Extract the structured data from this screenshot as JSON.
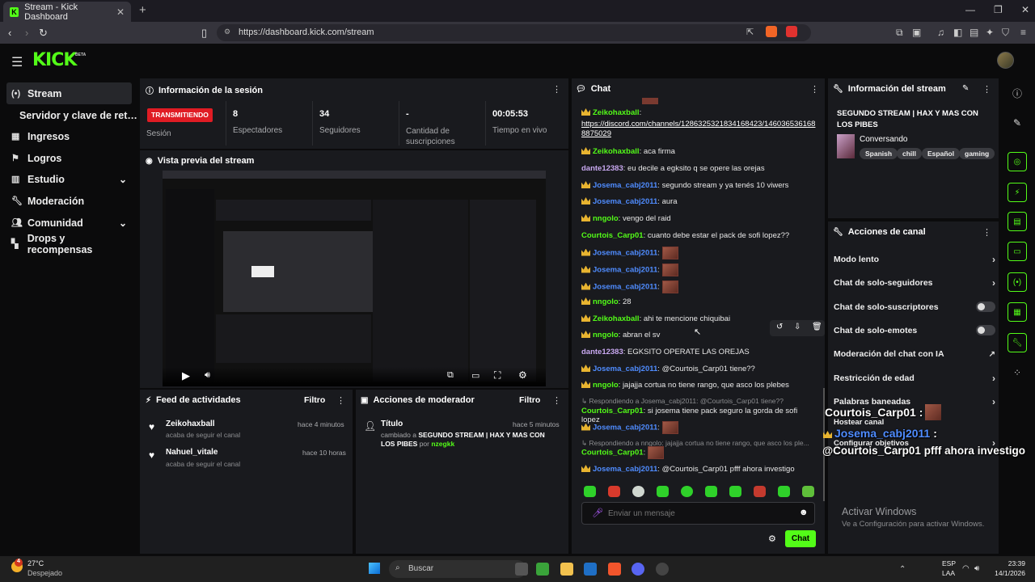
{
  "browser": {
    "tab_title": "Stream - Kick Dashboard",
    "url": "https://dashboard.kick.com/stream",
    "window_controls": [
      "minimize-icon",
      "restore-icon",
      "close-icon"
    ]
  },
  "app": {
    "logo": "KICK",
    "logo_badge": "BETA"
  },
  "sidebar": {
    "items": [
      {
        "label": "Stream",
        "icon": "broadcast-icon",
        "active": true
      },
      {
        "label": "Servidor y clave de retransmisión",
        "icon": "",
        "sub": true
      },
      {
        "label": "Ingresos",
        "icon": "bar-chart-icon"
      },
      {
        "label": "Logros",
        "icon": "flag-icon"
      },
      {
        "label": "Estudio",
        "icon": "grid-icon",
        "chevron": true
      },
      {
        "label": "Moderación",
        "icon": "wrench-icon"
      },
      {
        "label": "Comunidad",
        "icon": "people-icon",
        "chevron": true
      },
      {
        "label": "Drops y recompensas",
        "icon": "gift-icon"
      }
    ]
  },
  "session": {
    "title": "Información de la sesión",
    "live_badge": "TRANSMITIENDO",
    "stats": [
      {
        "value": "",
        "label": "Sesión"
      },
      {
        "value": "8",
        "label": "Espectadores"
      },
      {
        "value": "34",
        "label": "Seguidores"
      },
      {
        "value": "-",
        "label": "Cantidad de suscripciones"
      },
      {
        "value": "00:05:53",
        "label": "Tiempo en vivo"
      }
    ]
  },
  "preview": {
    "title": "Vista previa del stream"
  },
  "activity": {
    "title": "Feed de actividades",
    "filter": "Filtro",
    "items": [
      {
        "user": "Zeikohaxball",
        "text": "acaba de seguir el canal",
        "time": "hace 4 minutos"
      },
      {
        "user": "Nahuel_vitale",
        "text": "acaba de seguir el canal",
        "time": "hace 10 horas"
      }
    ]
  },
  "modactions": {
    "title": "Acciones de moderador",
    "filter": "Filtro",
    "item": {
      "label": "Título",
      "time": "hace 5 minutos",
      "text_prefix": "cambiado a ",
      "title_value": "SEGUNDO STREAM | HAX Y MAS CON LOS PIBES",
      "by": " por ",
      "mod": "nzegkk"
    }
  },
  "chat": {
    "title": "Chat",
    "lines": [
      {
        "user": "Zeikohaxball",
        "badge": true,
        "color": "#53fc18",
        "text": ""
      },
      {
        "user": "",
        "badge": false,
        "color": "#ffffff",
        "text": "https://discord.com/channels/1286325321834168423/1460365361688875029",
        "link": true
      },
      {
        "user": "Zeikohaxball",
        "badge": true,
        "color": "#53fc18",
        "text": "aca firma"
      },
      {
        "user": "dante12383",
        "badge": false,
        "color": "#c8a8f0",
        "text": "eu decile a egksito q se opere las orejas"
      },
      {
        "user": "Josema_cabj2011",
        "badge": true,
        "color": "#4f8cff",
        "text": "segundo stream y ya tenés 10 viwers"
      },
      {
        "user": "Josema_cabj2011",
        "badge": true,
        "color": "#4f8cff",
        "text": "aura"
      },
      {
        "user": "nngolo",
        "badge": true,
        "color": "#53fc18",
        "text": "vengo del raid"
      },
      {
        "user": "Courtois_Carp01",
        "badge": false,
        "color": "#53fc18",
        "text": "cuanto debe estar el pack de sofi lopez??"
      },
      {
        "user": "Josema_cabj2011",
        "badge": true,
        "color": "#4f8cff",
        "text": "",
        "emote": true
      },
      {
        "user": "Josema_cabj2011",
        "badge": true,
        "color": "#4f8cff",
        "text": "",
        "emote": true
      },
      {
        "user": "Josema_cabj2011",
        "badge": true,
        "color": "#4f8cff",
        "text": "",
        "emote": true
      },
      {
        "user": "nngolo",
        "badge": true,
        "color": "#53fc18",
        "text": "28"
      },
      {
        "user": "Zeikohaxball",
        "badge": true,
        "color": "#53fc18",
        "text": "ahi te mencione chiquibai"
      },
      {
        "user": "nngolo",
        "badge": true,
        "color": "#53fc18",
        "text": "abran el sv"
      },
      {
        "user": "dante12383",
        "badge": false,
        "color": "#c8a8f0",
        "text": "EGKSITO OPERATE LAS OREJAS"
      },
      {
        "user": "Josema_cabj2011",
        "badge": true,
        "color": "#4f8cff",
        "text": "@Courtois_Carp01 tiene??"
      },
      {
        "user": "nngolo",
        "badge": true,
        "color": "#53fc18",
        "text": "jajajja cortua no tiene rango, que asco los plebes"
      },
      {
        "reply": "Respondiendo a Josema_cabj2011: @Courtois_Carp01 tiene??"
      },
      {
        "user": "Courtois_Carp01",
        "badge": false,
        "color": "#53fc18",
        "text": "si josema tiene pack seguro la gorda de sofi lopez"
      },
      {
        "user": "Josema_cabj2011",
        "badge": true,
        "color": "#4f8cff",
        "text": "",
        "emote": true
      },
      {
        "reply": "Respondiendo a nngolo: jajajja cortua no tiene rango, que asco los ple..."
      },
      {
        "user": "Courtois_Carp01",
        "badge": false,
        "color": "#53fc18",
        "text": "",
        "emote": true
      },
      {
        "user": "Josema_cabj2011",
        "badge": true,
        "color": "#4f8cff",
        "text": "@Courtois_Carp01 pfff ahora investigo"
      }
    ],
    "input_placeholder": "Enviar un mensaje",
    "send_label": "Chat"
  },
  "stream_info": {
    "title": "Información del stream",
    "stream_title": "SEGUNDO STREAM | HAX Y MAS CON LOS PIBES",
    "category": "Conversando",
    "tags": [
      "Spanish",
      "chill",
      "Español",
      "gaming"
    ]
  },
  "channel_actions": {
    "title": "Acciones de canal",
    "items": [
      {
        "label": "Modo lento",
        "kind": "chevron"
      },
      {
        "label": "Chat de solo-seguidores",
        "kind": "chevron"
      },
      {
        "label": "Chat de solo-suscriptores",
        "kind": "toggle"
      },
      {
        "label": "Chat de solo-emotes",
        "kind": "toggle"
      },
      {
        "label": "Moderación del chat con IA",
        "kind": "external"
      },
      {
        "label": "Restricción de edad",
        "kind": "chevron"
      },
      {
        "label": "Palabras baneadas",
        "kind": "chevron"
      },
      {
        "label": "Hostear canal",
        "kind": "none"
      },
      {
        "label": "Configurar objetivos",
        "kind": "chevron"
      }
    ]
  },
  "overlay": {
    "user1": "Courtois_Carp01",
    "colon": " :",
    "user2": "Josema_cabj2011",
    "message": "@Courtois_Carp01 pfff ahora investigo"
  },
  "watermark": {
    "line1": "Activar Windows",
    "line2": "Ve a Configuración para activar Windows."
  },
  "taskbar": {
    "weather_temp": "27°C",
    "weather_desc": "Despejado",
    "notif_count": "4",
    "search": "Buscar",
    "lang1": "ESP",
    "lang2": "LAA",
    "time": "23:39",
    "date": "14/1/2026"
  }
}
